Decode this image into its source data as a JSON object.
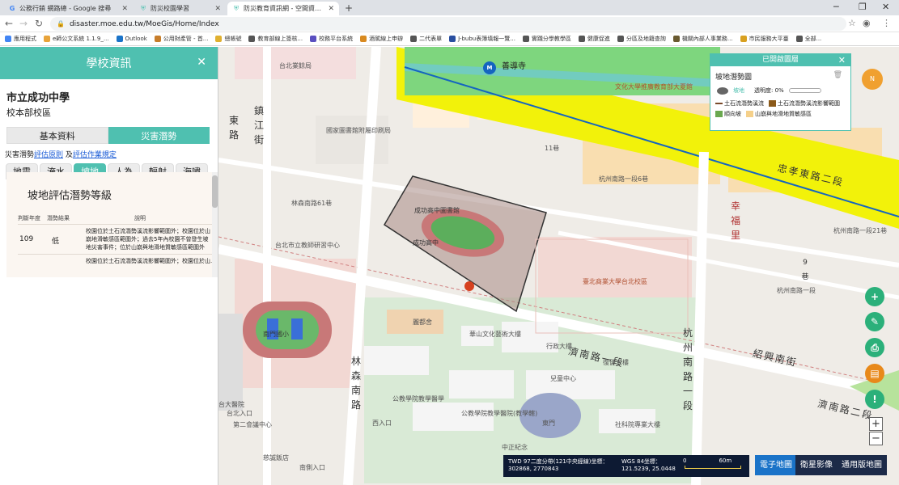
{
  "browser": {
    "tabs": [
      {
        "title": "公務行銷 網路總 - Google 搜尋",
        "favicon": "google-icon"
      },
      {
        "title": "防災校園學習",
        "favicon": "shield-icon"
      },
      {
        "title": "防災教育資訊網 - 空間資訊系統",
        "favicon": "shield-icon"
      }
    ],
    "url": "disaster.moe.edu.tw/MoeGis/Home/Index",
    "bookmarks": [
      "應用程式",
      "e師公文系統 1.1.9_...",
      "Outlook",
      "公用財產管 - 首...",
      "總帳號",
      "教育部線上簽核...",
      "校務平台系統",
      "酒駕線上申辦",
      "二代表單",
      "J-bubu表簿填報一覽...",
      "實踐分學教學區",
      "健康促進",
      "分區及地籍查詢",
      "機關內部人事業務...",
      "市民服務大平臺",
      "全部..."
    ]
  },
  "panel": {
    "header": "學校資訊",
    "school_name": "市立成功中學",
    "campus": "校本部校區",
    "tabs": [
      "基本資料",
      "災害潛勢"
    ],
    "links_prefix": "災害潛勢",
    "link1": "評估原則",
    "links_mid": "及",
    "link2": "評估作業規定",
    "hazard_tabs": [
      "地震",
      "淹水",
      "坡地",
      "人為",
      "輻射",
      "海嘯"
    ],
    "hazard_title": "坡地評估潛勢等級",
    "table_headers": [
      "判斷年度",
      "潛勢結果",
      "說明"
    ],
    "row": {
      "year": "109",
      "result": "低",
      "desc": "校園位於土石流潛勢溪流影響範圍外；校園位於山崩地滑敏感區範圍外；過去5年內校園不曾發生坡地災害事件；位於山崩與地滑地質敏感區範圍外"
    },
    "row2_desc": "校園位於土石流潛勢溪流影響範圍外；校園位於山..."
  },
  "legend": {
    "title": "已開啟圖層",
    "layer": "坡地潛勢圖",
    "layer_sub": "坡地",
    "opacity_label": "透明度: 0%",
    "items": [
      {
        "label": "土石流潛勢溪流",
        "color": "#7a4a2a"
      },
      {
        "label": "土石流潛勢溪流影響範圍",
        "color": "#8b5a1a"
      },
      {
        "label": "順向坡",
        "color": "#6aa84f"
      },
      {
        "label": "山崩與地滑地質敏感區",
        "color": "#f5d08a"
      }
    ]
  },
  "map": {
    "labels": {
      "station": "善導寺",
      "ntub": "文化大學推廣教育部大夏館",
      "ejiang": "鎮江街",
      "eastroad": "東路",
      "jinan2": "濟南路二段",
      "jinan1": "濟南路一段",
      "zhongxiao": "忠孝東路二段",
      "lane11": "11巷",
      "hangzhou1": "杭州南路一段6巷",
      "hangzhou21": "杭州南路一段21巷",
      "hangzhou": "杭州南路一段",
      "hangzhou_v": "杭州南路一段",
      "lane9": "9巷",
      "xinsheng": "幸福里",
      "linsen": "林森南路",
      "linsen61": "林森南路61巷",
      "chenggong": "成功高中",
      "chenggong_hall": "成功高中圖書館",
      "taipei_ntu": "臺北商業大學台北校區",
      "ntue": "國立臺北科技大學",
      "police": "國家圖書館附屬印刷局",
      "taipei_police": "台北業餘局",
      "school_west": "南門國小",
      "lijiao": "台北市立教師研習中心",
      "dimu": "麗都舍",
      "tai": "台大醫院",
      "jinan_v": "濟南路",
      "huashan": "華山文化藝術大樓",
      "shaoxing": "紹興南街",
      "east_gate": "東門",
      "lane_n": "第二會議中心",
      "temple": "行政大樓",
      "cn_center": "社科院專業大樓",
      "child": "兒童中心",
      "rehab": "復健大樓",
      "museum": "中正紀念",
      "tainan": "台北入口",
      "west_entry": "西入口",
      "nanshi": "南側入口",
      "police_hall": "公教學院教學醫學",
      "nursing": "公教學院教學醫院(教學轄)",
      "hotel": "慈誠飯店",
      "hangzhou_nan": "杭州南路一段"
    },
    "coords": {
      "twd_label": "TWD 97二度分帶(121中央經線)坐標：",
      "twd_value": "302868, 2770843",
      "wgs_label": "WGS 84坐標：",
      "wgs_value": "121.5239, 25.0448",
      "scale_zero": "0",
      "scale_max": "60m"
    },
    "basemaps": [
      "電子地圖",
      "衛星影像",
      "通用版地圖"
    ],
    "compass": "N"
  },
  "colors": {
    "teal": "#4fc0b0",
    "yellow": "#f2f20a",
    "green": "#7ed67e"
  }
}
